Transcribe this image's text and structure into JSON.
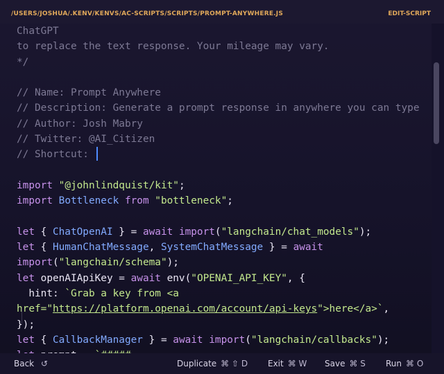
{
  "titlebar": {
    "path": "/USERS/JOSHUA/.KENV/KENVS/AC-SCRIPTS/SCRIPTS/PROMPT-ANYWHERE.JS",
    "mode": "EDIT-SCRIPT"
  },
  "editor": {
    "lines": [
      [
        {
          "t": "ChatGPT",
          "c": "cm"
        }
      ],
      [
        {
          "t": "to replace the text response. Your mileage may vary.",
          "c": "cm"
        }
      ],
      [
        {
          "t": "*/",
          "c": "cm"
        }
      ],
      [],
      [
        {
          "t": "// Name: Prompt Anywhere",
          "c": "cm"
        }
      ],
      [
        {
          "t": "// Description: Generate a prompt response in anywhere you can type",
          "c": "cm"
        }
      ],
      [
        {
          "t": "// Author: Josh Mabry",
          "c": "cm"
        }
      ],
      [
        {
          "t": "// Twitter: @AI_Citizen",
          "c": "cm"
        }
      ],
      [
        {
          "t": "// Shortcut: ",
          "c": "cm"
        },
        {
          "cursor": true
        }
      ],
      [],
      [
        {
          "t": "import ",
          "c": "kw"
        },
        {
          "t": "\"@johnlindquist/kit\"",
          "c": "str"
        },
        {
          "t": ";",
          "c": "p"
        }
      ],
      [
        {
          "t": "import ",
          "c": "kw"
        },
        {
          "t": "Bottleneck",
          "c": "cls"
        },
        {
          "t": " from ",
          "c": "kw"
        },
        {
          "t": "\"bottleneck\"",
          "c": "str"
        },
        {
          "t": ";",
          "c": "p"
        }
      ],
      [],
      [
        {
          "t": "let ",
          "c": "kw"
        },
        {
          "t": "{ ",
          "c": "p"
        },
        {
          "t": "ChatOpenAI",
          "c": "cls"
        },
        {
          "t": " } = ",
          "c": "p"
        },
        {
          "t": "await ",
          "c": "kw"
        },
        {
          "t": "import",
          "c": "kw"
        },
        {
          "t": "(",
          "c": "p"
        },
        {
          "t": "\"langchain/chat_models\"",
          "c": "str"
        },
        {
          "t": ");",
          "c": "p"
        }
      ],
      [
        {
          "t": "let ",
          "c": "kw"
        },
        {
          "t": "{ ",
          "c": "p"
        },
        {
          "t": "HumanChatMessage",
          "c": "cls"
        },
        {
          "t": ", ",
          "c": "p"
        },
        {
          "t": "SystemChatMessage",
          "c": "cls"
        },
        {
          "t": " } = ",
          "c": "p"
        },
        {
          "t": "await",
          "c": "kw"
        }
      ],
      [
        {
          "t": "import",
          "c": "kw"
        },
        {
          "t": "(",
          "c": "p"
        },
        {
          "t": "\"langchain/schema\"",
          "c": "str"
        },
        {
          "t": ");",
          "c": "p"
        }
      ],
      [
        {
          "t": "let ",
          "c": "kw"
        },
        {
          "t": "openAIApiKey",
          "c": "var"
        },
        {
          "t": " = ",
          "c": "p"
        },
        {
          "t": "await ",
          "c": "kw"
        },
        {
          "t": "env",
          "c": "var"
        },
        {
          "t": "(",
          "c": "p"
        },
        {
          "t": "\"OPENAI_API_KEY\"",
          "c": "str"
        },
        {
          "t": ", {",
          "c": "p"
        }
      ],
      [
        {
          "t": "  hint",
          "c": "var"
        },
        {
          "t": ": ",
          "c": "p"
        },
        {
          "t": "`Grab a key from <a",
          "c": "str"
        }
      ],
      [
        {
          "t": "href=\"",
          "c": "str"
        },
        {
          "t": "https://platform.openai.com/account/api-keys",
          "c": "str",
          "u": true
        },
        {
          "t": "\">here</a>`",
          "c": "str"
        },
        {
          "t": ",",
          "c": "p"
        }
      ],
      [
        {
          "t": "});",
          "c": "p"
        }
      ],
      [
        {
          "t": "let ",
          "c": "kw"
        },
        {
          "t": "{ ",
          "c": "p"
        },
        {
          "t": "CallbackManager",
          "c": "cls"
        },
        {
          "t": " } = ",
          "c": "p"
        },
        {
          "t": "await ",
          "c": "kw"
        },
        {
          "t": "import",
          "c": "kw"
        },
        {
          "t": "(",
          "c": "p"
        },
        {
          "t": "\"langchain/callbacks\"",
          "c": "str"
        },
        {
          "t": ");",
          "c": "p"
        }
      ],
      [
        {
          "t": "let ",
          "c": "kw"
        },
        {
          "t": "prompt",
          "c": "var"
        },
        {
          "t": " = ",
          "c": "p"
        },
        {
          "t": "`#####",
          "c": "str"
        }
      ]
    ]
  },
  "footer": {
    "back": {
      "label": "Back",
      "icon": "↺"
    },
    "duplicate": {
      "label": "Duplicate",
      "keys": "⌘ ⇧ D"
    },
    "exit": {
      "label": "Exit",
      "keys": "⌘ W"
    },
    "save": {
      "label": "Save",
      "keys": "⌘ S"
    },
    "run": {
      "label": "Run",
      "keys": "⌘ O"
    }
  }
}
